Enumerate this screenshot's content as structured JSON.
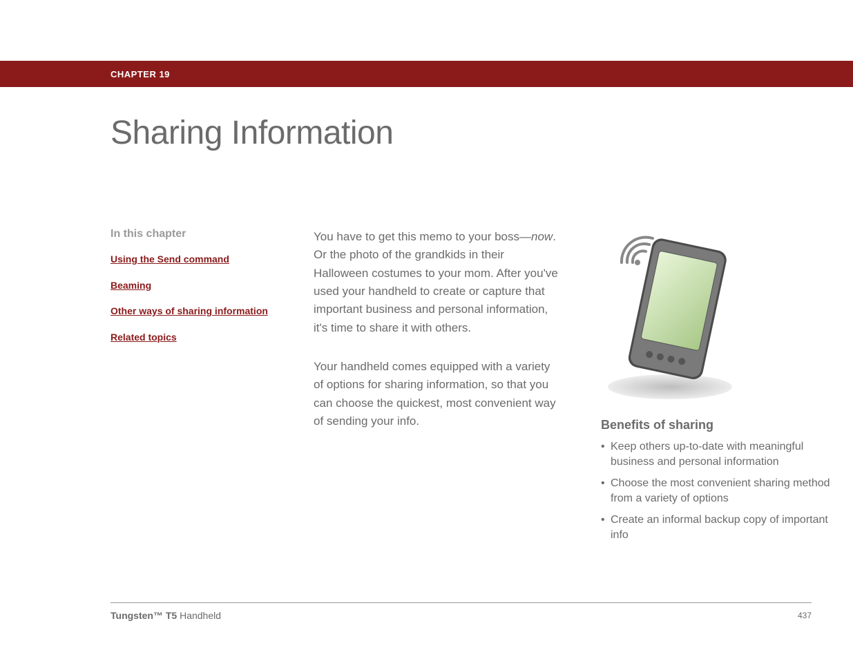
{
  "header": {
    "chapter_label": "CHAPTER 19"
  },
  "title": "Sharing Information",
  "sidebar": {
    "heading": "In this chapter",
    "links": [
      "Using the Send command",
      "Beaming",
      "Other ways of sharing information",
      "Related topics"
    ]
  },
  "main": {
    "para1_pre": "You have to get this memo to your boss—",
    "para1_em": "now",
    "para1_post": ". Or the photo of the grandkids in their Halloween costumes to your mom. After you've used your handheld to create or capture that important business and personal information, it's time to share it with others.",
    "para2": "Your handheld comes equipped with a variety of options for sharing information, so that you can choose the quickest, most convenient way of sending your info."
  },
  "benefits": {
    "heading": "Benefits of sharing",
    "items": [
      "Keep others up-to-date with meaningful business and personal information",
      "Choose the most convenient sharing method from a variety of options",
      "Create an informal backup copy of important info"
    ]
  },
  "footer": {
    "product_bold": "Tungsten™ T5",
    "product_rest": " Handheld",
    "page_number": "437"
  }
}
